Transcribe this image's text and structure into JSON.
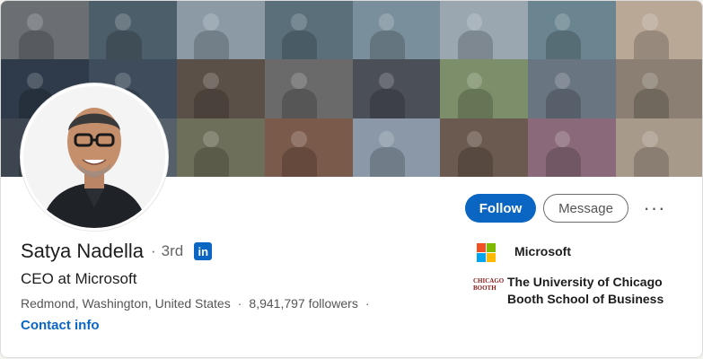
{
  "profile": {
    "name": "Satya Nadella",
    "degree_separator": "·",
    "degree": "3rd",
    "badge": "in",
    "headline": "CEO at Microsoft",
    "location": "Redmond, Washington, United States",
    "meta_separator": "·",
    "followers": "8,941,797 followers",
    "trailing_dot": "·",
    "contact_info": "Contact info"
  },
  "actions": {
    "follow": "Follow",
    "message": "Message",
    "more": "···"
  },
  "organizations": [
    {
      "name": "Microsoft",
      "icon": "microsoft-logo"
    },
    {
      "name_line1": "The University of Chicago",
      "name_line2": "Booth School of Business",
      "logo_line1": "CHICAGO",
      "logo_line2": "BOOTH",
      "icon": "chicago-booth-logo"
    }
  ],
  "colors": {
    "accent": "#0a66c2",
    "ms_red": "#f25022",
    "ms_green": "#7fba00",
    "ms_blue": "#00a4ef",
    "ms_yellow": "#ffb900"
  }
}
